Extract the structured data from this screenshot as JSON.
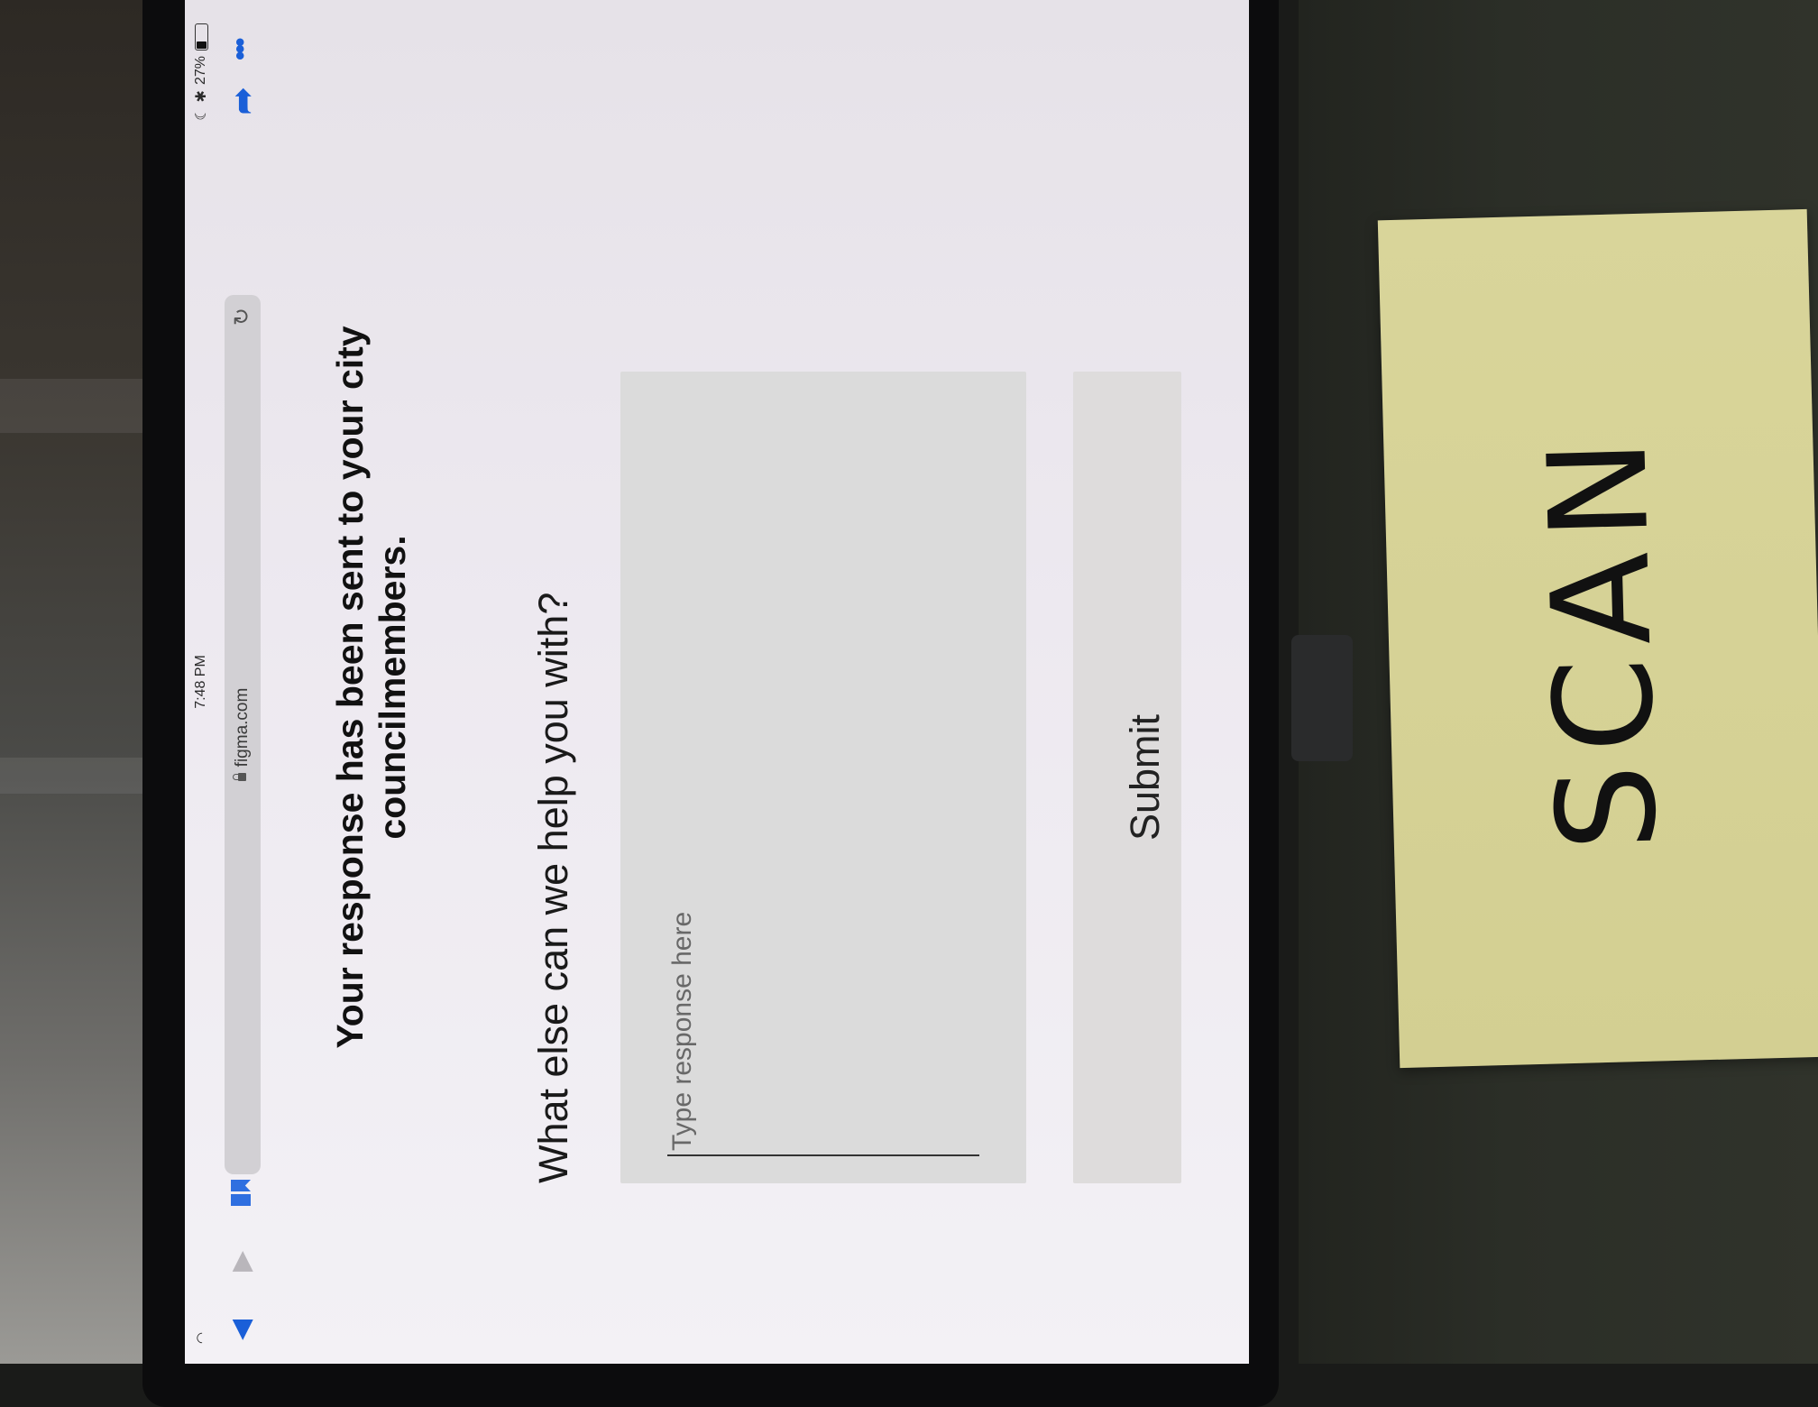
{
  "status_bar": {
    "time": "7:48 PM",
    "battery_text": "27%",
    "battery_level": 0.27
  },
  "browser": {
    "url": "figma.com",
    "icons": {
      "back": "chevron-left-icon",
      "forward": "chevron-right-icon",
      "bookmarks": "bookmarks-icon",
      "lock": "lock-icon",
      "reload": "reload-icon",
      "share": "share-icon",
      "more": "more-icon"
    }
  },
  "page": {
    "headline": "Your response has been sent to your city councilmembers.",
    "question": "What else can we help you with?",
    "response": {
      "placeholder": "Type response here",
      "value": ""
    },
    "submit_label": "Submit"
  },
  "sticky_note": {
    "text": "SCAN"
  },
  "colors": {
    "accent_blue": "#1a5fd8",
    "input_background": "#dbdbdb",
    "sticky_note": "#d6d296"
  }
}
